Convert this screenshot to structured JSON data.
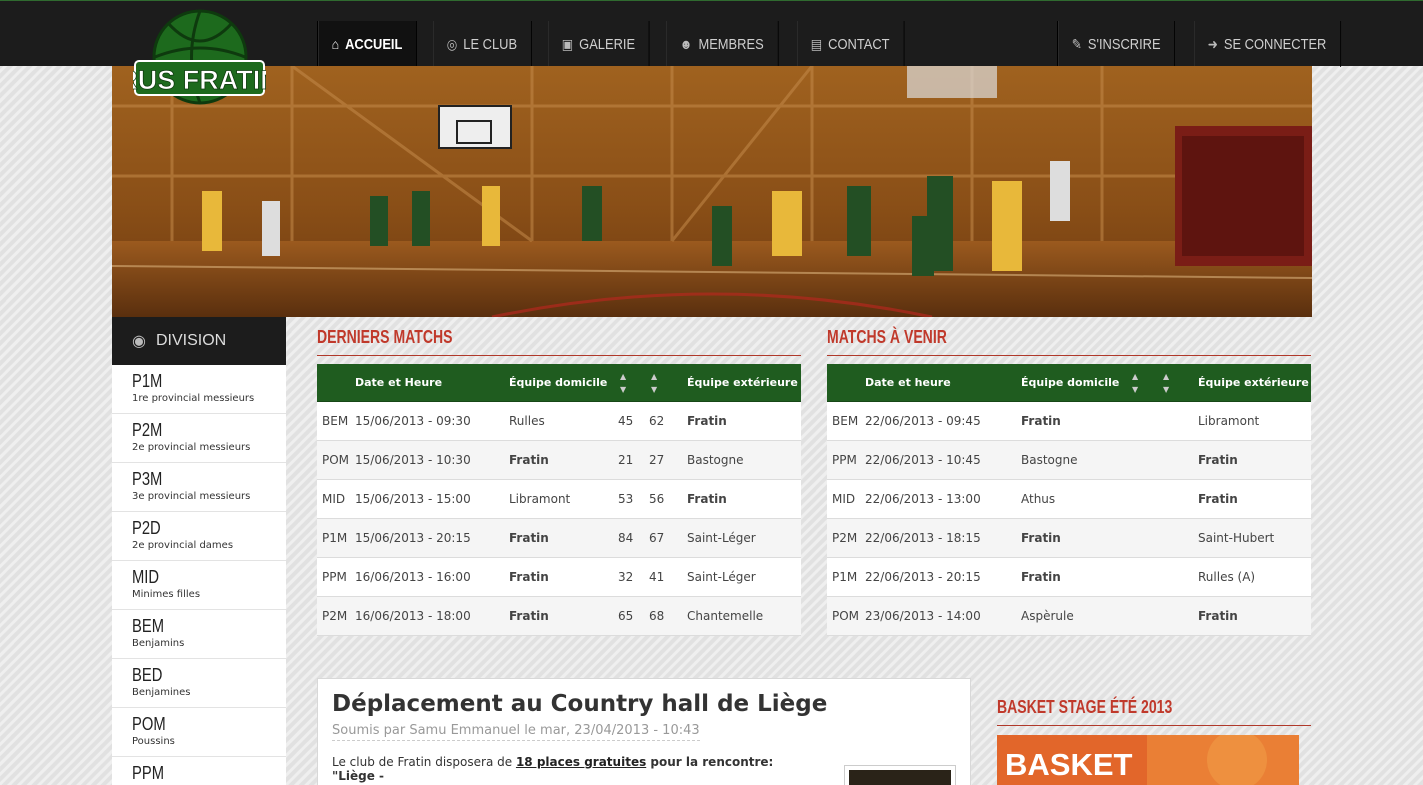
{
  "nav": {
    "left": [
      {
        "label": "Accueil",
        "icon": "home-icon",
        "active": true
      },
      {
        "label": "Le club",
        "icon": "basketball-icon",
        "active": false
      },
      {
        "label": "Galerie",
        "icon": "image-icon",
        "active": false
      },
      {
        "label": "Membres",
        "icon": "users-icon",
        "active": false
      },
      {
        "label": "Contact",
        "icon": "contact-card-icon",
        "active": false
      }
    ],
    "right": [
      {
        "label": "S'inscrire",
        "icon": "pencil-icon"
      },
      {
        "label": "Se connecter",
        "icon": "sign-in-icon"
      }
    ]
  },
  "logo": {
    "text": "RUS FRATIN"
  },
  "sidebar": {
    "title": "Division",
    "items": [
      {
        "code": "P1M",
        "label": "1re provincial messieurs"
      },
      {
        "code": "P2M",
        "label": "2e provincial messieurs"
      },
      {
        "code": "P3M",
        "label": "3e provincial messieurs"
      },
      {
        "code": "P2D",
        "label": "2e provincial dames"
      },
      {
        "code": "MID",
        "label": "Minimes filles"
      },
      {
        "code": "BEM",
        "label": "Benjamins"
      },
      {
        "code": "BED",
        "label": "Benjamines"
      },
      {
        "code": "POM",
        "label": "Poussins"
      },
      {
        "code": "PPM",
        "label": ""
      }
    ]
  },
  "last_matches": {
    "title": "Derniers matchs",
    "headers": {
      "date": "Date et Heure",
      "home": "Équipe domicile",
      "away": "Équipe extérieure"
    },
    "rows": [
      {
        "div": "BEM",
        "date": "15/06/2013 - 09:30",
        "home": "Rulles",
        "home_bold": false,
        "s1": "45",
        "s2": "62",
        "c1": "g",
        "c2": "g",
        "away": "Fratin",
        "away_bold": true
      },
      {
        "div": "POM",
        "date": "15/06/2013 - 10:30",
        "home": "Fratin",
        "home_bold": true,
        "s1": "21",
        "s2": "27",
        "c1": "r",
        "c2": "r",
        "away": "Bastogne",
        "away_bold": false
      },
      {
        "div": "MID",
        "date": "15/06/2013 - 15:00",
        "home": "Libramont",
        "home_bold": false,
        "s1": "53",
        "s2": "56",
        "c1": "g",
        "c2": "g",
        "away": "Fratin",
        "away_bold": true
      },
      {
        "div": "P1M",
        "date": "15/06/2013 - 20:15",
        "home": "Fratin",
        "home_bold": true,
        "s1": "84",
        "s2": "67",
        "c1": "g",
        "c2": "g",
        "away": "Saint-Léger",
        "away_bold": false
      },
      {
        "div": "PPM",
        "date": "16/06/2013 - 16:00",
        "home": "Fratin",
        "home_bold": true,
        "s1": "32",
        "s2": "41",
        "c1": "r",
        "c2": "r",
        "away": "Saint-Léger",
        "away_bold": false
      },
      {
        "div": "P2M",
        "date": "16/06/2013 - 18:00",
        "home": "Fratin",
        "home_bold": true,
        "s1": "65",
        "s2": "68",
        "c1": "r",
        "c2": "r",
        "away": "Chantemelle",
        "away_bold": false
      }
    ]
  },
  "upcoming_matches": {
    "title": "Matchs à venir",
    "headers": {
      "date": "Date et heure",
      "home": "Équipe domicile",
      "away": "Équipe extérieure"
    },
    "rows": [
      {
        "div": "BEM",
        "date": "22/06/2013 - 09:45",
        "home": "Fratin",
        "home_bold": true,
        "away": "Libramont",
        "away_bold": false
      },
      {
        "div": "PPM",
        "date": "22/06/2013 - 10:45",
        "home": "Bastogne",
        "home_bold": false,
        "away": "Fratin",
        "away_bold": true
      },
      {
        "div": "MID",
        "date": "22/06/2013 - 13:00",
        "home": "Athus",
        "home_bold": false,
        "away": "Fratin",
        "away_bold": true
      },
      {
        "div": "P2M",
        "date": "22/06/2013 - 18:15",
        "home": "Fratin",
        "home_bold": true,
        "away": "Saint-Hubert",
        "away_bold": false
      },
      {
        "div": "P1M",
        "date": "22/06/2013 - 20:15",
        "home": "Fratin",
        "home_bold": true,
        "away": "Rulles (A)",
        "away_bold": false
      },
      {
        "div": "POM",
        "date": "23/06/2013 - 14:00",
        "home": "Aspèrule",
        "home_bold": false,
        "away": "Fratin",
        "away_bold": true
      }
    ]
  },
  "article": {
    "title": "Déplacement au Country hall de Liège",
    "meta": "Soumis par Samu Emmanuel le mar, 23/04/2013 - 10:43",
    "body_prefix": "Le club de Fratin disposera de ",
    "body_link": "18 places gratuites",
    "body_suffix": " pour la rencontre: \"Liège -"
  },
  "stage": {
    "title": "Basket stage été 2013",
    "image_text": "BASKET"
  },
  "colors": {
    "accent_red": "#c0392b",
    "table_green": "#1f5c1f",
    "link_green": "#2a8a2a",
    "loss_red": "#d42a2a"
  }
}
